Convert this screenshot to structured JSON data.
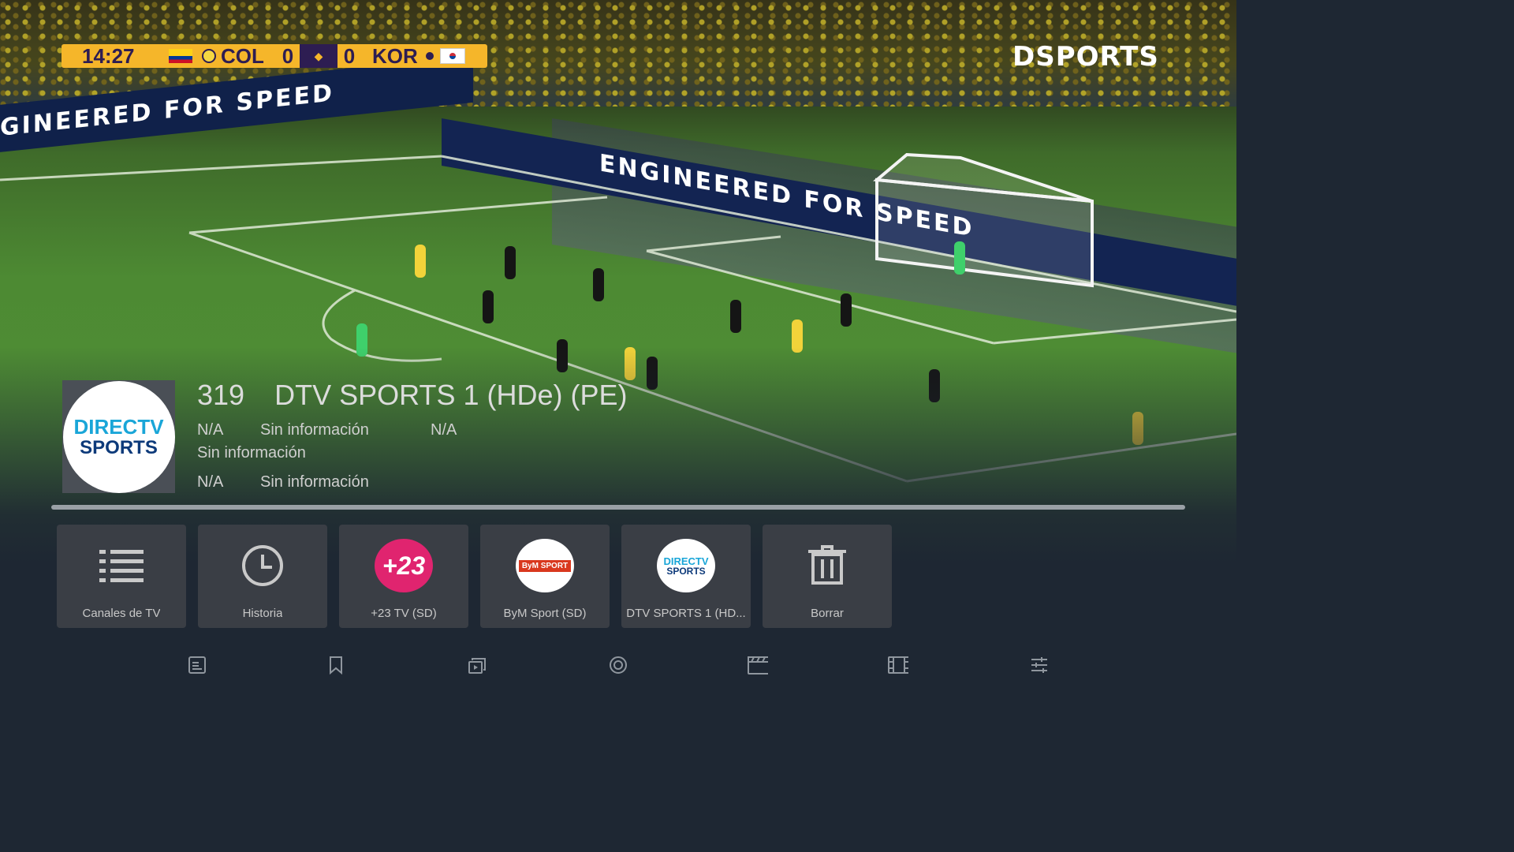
{
  "scoreboard": {
    "time": "14:27",
    "home_team": "COL",
    "home_score": "0",
    "away_score": "0",
    "away_team": "KOR"
  },
  "broadcaster_logo": "DSPORTS",
  "ad_boards": {
    "left": "GINEERED FOR SPEED",
    "right": "ENGINEERED FOR SPEED"
  },
  "channel": {
    "number": "319",
    "name": "DTV SPORTS 1 (HDe) (PE)",
    "logo_line1": "DIRECTV",
    "logo_line2": "SPORTS",
    "now_time": "N/A",
    "now_title": "Sin información",
    "now_extra": "N/A",
    "now_desc": "Sin información",
    "next_time": "N/A",
    "next_title": "Sin información"
  },
  "tiles": [
    {
      "label": "Canales de TV",
      "icon": "list-icon"
    },
    {
      "label": "Historia",
      "icon": "clock-icon"
    },
    {
      "label": "+23 TV (SD)",
      "icon": "plus23-logo",
      "logo_text": "+23",
      "color": "#e0246f"
    },
    {
      "label": "ByM Sport (SD)",
      "icon": "bym-sport-logo",
      "logo_text": "ByM SPORT",
      "color": "#d9381e"
    },
    {
      "label": "DTV SPORTS 1 (HD...",
      "icon": "directv-sports-logo",
      "logo_line1": "DIRECTV",
      "logo_line2": "SPORTS"
    },
    {
      "label": "Borrar",
      "icon": "trash-icon"
    }
  ],
  "nav": [
    {
      "icon": "guide-icon"
    },
    {
      "icon": "bookmark-icon"
    },
    {
      "icon": "multiview-icon"
    },
    {
      "icon": "record-icon"
    },
    {
      "icon": "clapperboard-icon"
    },
    {
      "icon": "film-icon"
    },
    {
      "icon": "settings-sliders-icon"
    }
  ]
}
